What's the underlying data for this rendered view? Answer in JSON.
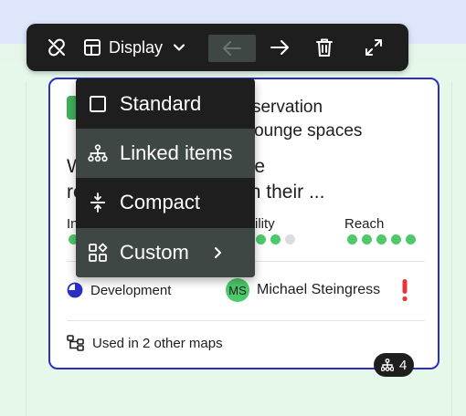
{
  "toolbar": {
    "display_label": "Display",
    "icons": [
      "unlink-icon",
      "layout-icon",
      "chevron-down-icon",
      "arrow-left-icon",
      "arrow-right-icon",
      "trash-icon",
      "expand-icon"
    ]
  },
  "display_menu": {
    "items": [
      {
        "label": "Standard",
        "icon": "square-icon",
        "highlighted": false
      },
      {
        "label": "Linked items",
        "icon": "hierarchy-icon",
        "highlighted": true
      },
      {
        "label": "Compact",
        "icon": "compress-icon",
        "highlighted": false
      },
      {
        "label": "Custom",
        "icon": "custom-layout-icon",
        "highlighted": true,
        "has_submenu": true
      }
    ]
  },
  "card": {
    "title_line1": "al reservation",
    "title_line2": "ess lounge spaces",
    "description_line1": "W                    a lounge",
    "description_line2": "re                     through their ...",
    "metrics": [
      {
        "label": "In",
        "dots_filled": 1,
        "dots_total": 1
      },
      {
        "label": "ility",
        "dots_filled": 2,
        "dots_total": 3
      },
      {
        "label": "Reach",
        "dots_filled": 5,
        "dots_total": 5
      }
    ],
    "status": "Development",
    "owner_initials": "MS",
    "owner_name": "Michael Steingress",
    "used_in": "Used in 2 other maps",
    "linked_count": "4"
  },
  "colors": {
    "accent_border": "#2b2fc4",
    "green": "#4cc96b",
    "alert": "#e5373a",
    "menu_bg": "#1e1e1e",
    "menu_hl": "#3f4744"
  }
}
